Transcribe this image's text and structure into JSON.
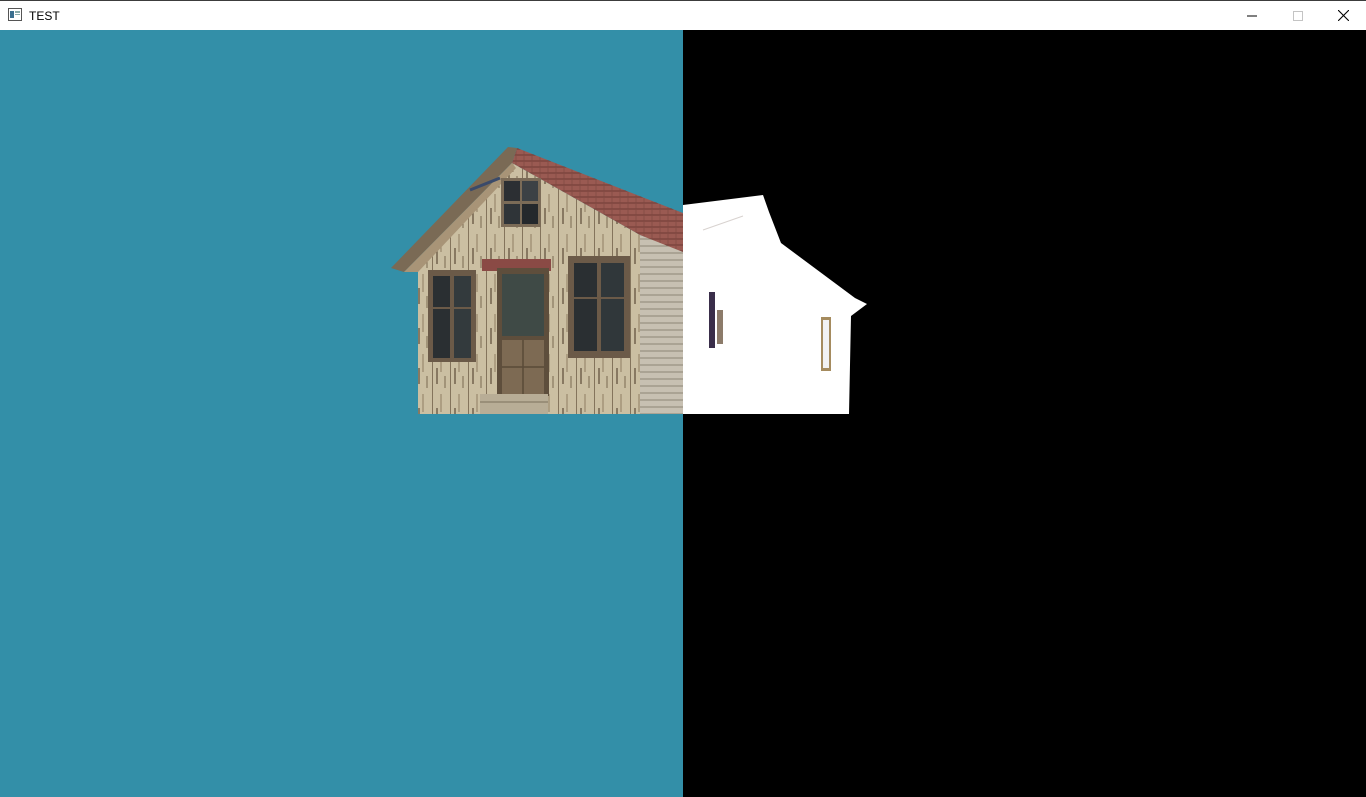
{
  "window": {
    "title": "TEST",
    "controls": {
      "minimize": "minimize-icon",
      "maximize": "maximize-icon",
      "close": "close-icon"
    }
  },
  "viewport": {
    "left_pane": {
      "background": "#338fa8",
      "content": "textured-house"
    },
    "right_pane": {
      "background": "#000000",
      "content": "white-house-silhouette"
    }
  }
}
